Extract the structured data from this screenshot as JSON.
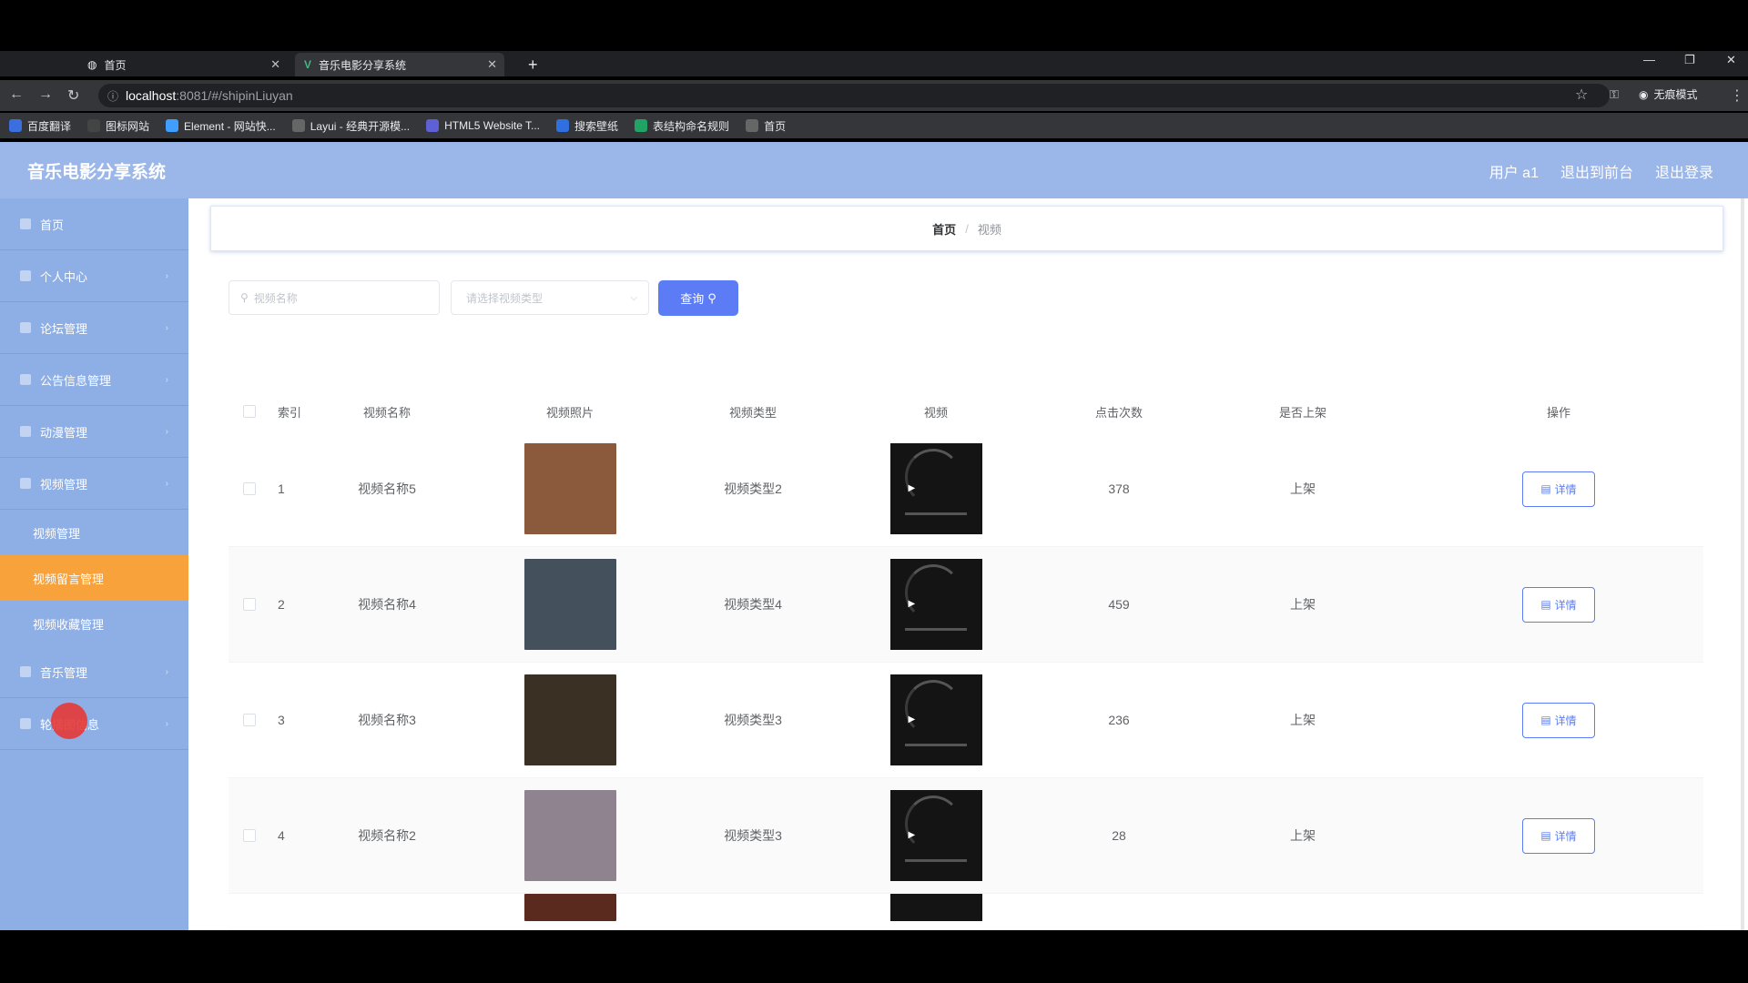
{
  "browser": {
    "tabs": [
      {
        "label": "首页"
      },
      {
        "label": "音乐电影分享系统"
      }
    ],
    "url_host": "localhost",
    "url_path": ":8081/#/shipinLiuyan",
    "profile_label": "无痕模式",
    "bookmarks": [
      {
        "label": "百度翻译",
        "color": "#3b6fe0"
      },
      {
        "label": "图标网站",
        "color": "#444"
      },
      {
        "label": "Element - 网站快...",
        "color": "#409eff"
      },
      {
        "label": "Layui - 经典开源模...",
        "color": "#666"
      },
      {
        "label": "HTML5 Website T...",
        "color": "#5f5fd6"
      },
      {
        "label": "搜索壁纸",
        "color": "#2f6fe0"
      },
      {
        "label": "表结构命名规则",
        "color": "#21a366"
      },
      {
        "label": "首页",
        "color": "#666"
      }
    ]
  },
  "header": {
    "brand": "音乐电影分享系统",
    "user": "用户 a1",
    "to_front": "退出到前台",
    "logout": "退出登录"
  },
  "sidebar": {
    "items": [
      {
        "label": "首页"
      },
      {
        "label": "个人中心"
      },
      {
        "label": "论坛管理"
      },
      {
        "label": "公告信息管理"
      },
      {
        "label": "动漫管理"
      },
      {
        "label": "视频管理"
      }
    ],
    "sub_items": [
      {
        "label": "视频管理"
      },
      {
        "label": "视频留言管理"
      },
      {
        "label": "视频收藏管理"
      }
    ],
    "items_after": [
      {
        "label": "音乐管理"
      },
      {
        "label": "轮播图信息"
      }
    ]
  },
  "breadcrumb": {
    "home": "首页",
    "separator": "/",
    "current": "视频"
  },
  "search": {
    "placeholder": "视频名称",
    "select_placeholder": "请选择视频类型",
    "query_label": "查询"
  },
  "table": {
    "headers": {
      "index": "索引",
      "name": "视频名称",
      "image": "视频照片",
      "type": "视频类型",
      "video": "视频",
      "clicks": "点击次数",
      "status": "是否上架",
      "op": "操作"
    },
    "rows": [
      {
        "index": "1",
        "name": "视频名称5",
        "type": "视频类型2",
        "clicks": "378",
        "status": "上架",
        "detail": "详情",
        "thumb_color": "#8b5a3c"
      },
      {
        "index": "2",
        "name": "视频名称4",
        "type": "视频类型4",
        "clicks": "459",
        "status": "上架",
        "detail": "详情",
        "thumb_color": "#44515d"
      },
      {
        "index": "3",
        "name": "视频名称3",
        "type": "视频类型3",
        "clicks": "236",
        "status": "上架",
        "detail": "详情",
        "thumb_color": "#3a3024"
      },
      {
        "index": "4",
        "name": "视频名称2",
        "type": "视频类型3",
        "clicks": "28",
        "status": "上架",
        "detail": "详情",
        "thumb_color": "#8f8390"
      }
    ]
  },
  "colors": {
    "header": "#9bb6e8",
    "sidebar": "#8eaee6",
    "active_menu": "#f7a23b",
    "primary": "#5b7cf5"
  }
}
